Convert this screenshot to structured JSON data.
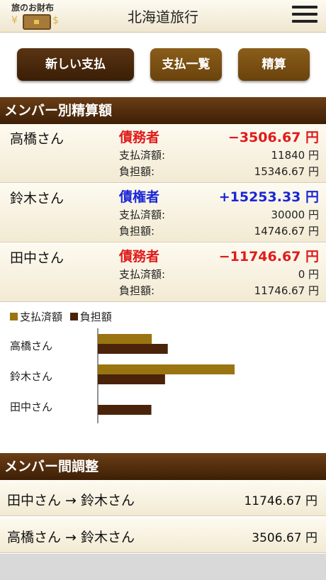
{
  "header": {
    "logo_title": "旅のお財布",
    "title": "北海道旅行",
    "menu_icon": "hamburger-menu-icon"
  },
  "toolbar": {
    "new_payment": "新しい支払",
    "payment_list": "支払一覧",
    "settle": "精算"
  },
  "members_section": {
    "title": "メンバー別精算額",
    "paid_label": "支払済額:",
    "burden_label": "負担額:",
    "members": [
      {
        "name": "高橋さん",
        "role": "債務者",
        "balance": "−3506.67 円",
        "paid": "11840 円",
        "burden": "15346.67 円"
      },
      {
        "name": "鈴木さん",
        "role": "債権者",
        "balance": "+15253.33 円",
        "paid": "30000 円",
        "burden": "14746.67 円"
      },
      {
        "name": "田中さん",
        "role": "債務者",
        "balance": "−11746.67 円",
        "paid": "0 円",
        "burden": "11746.67 円"
      }
    ]
  },
  "chart_data": {
    "type": "bar",
    "orientation": "horizontal",
    "categories": [
      "高橋さん",
      "鈴木さん",
      "田中さん"
    ],
    "series": [
      {
        "name": "支払済額",
        "values": [
          11840,
          30000,
          0
        ],
        "color": "#9a7411"
      },
      {
        "name": "負担額",
        "values": [
          15346.67,
          14746.67,
          11746.67
        ],
        "color": "#4a230a"
      }
    ],
    "legend": "top-left",
    "grid": false
  },
  "adjustments_section": {
    "title": "メンバー間調整",
    "items": [
      {
        "description": "田中さん → 鈴木さん",
        "amount": "11746.67 円"
      },
      {
        "description": "高橋さん → 鈴木さん",
        "amount": "3506.67 円"
      }
    ]
  },
  "colors": {
    "header_brown": "#3d1f06",
    "debtor_red": "#e01b1b",
    "creditor_blue": "#1b27d6"
  }
}
